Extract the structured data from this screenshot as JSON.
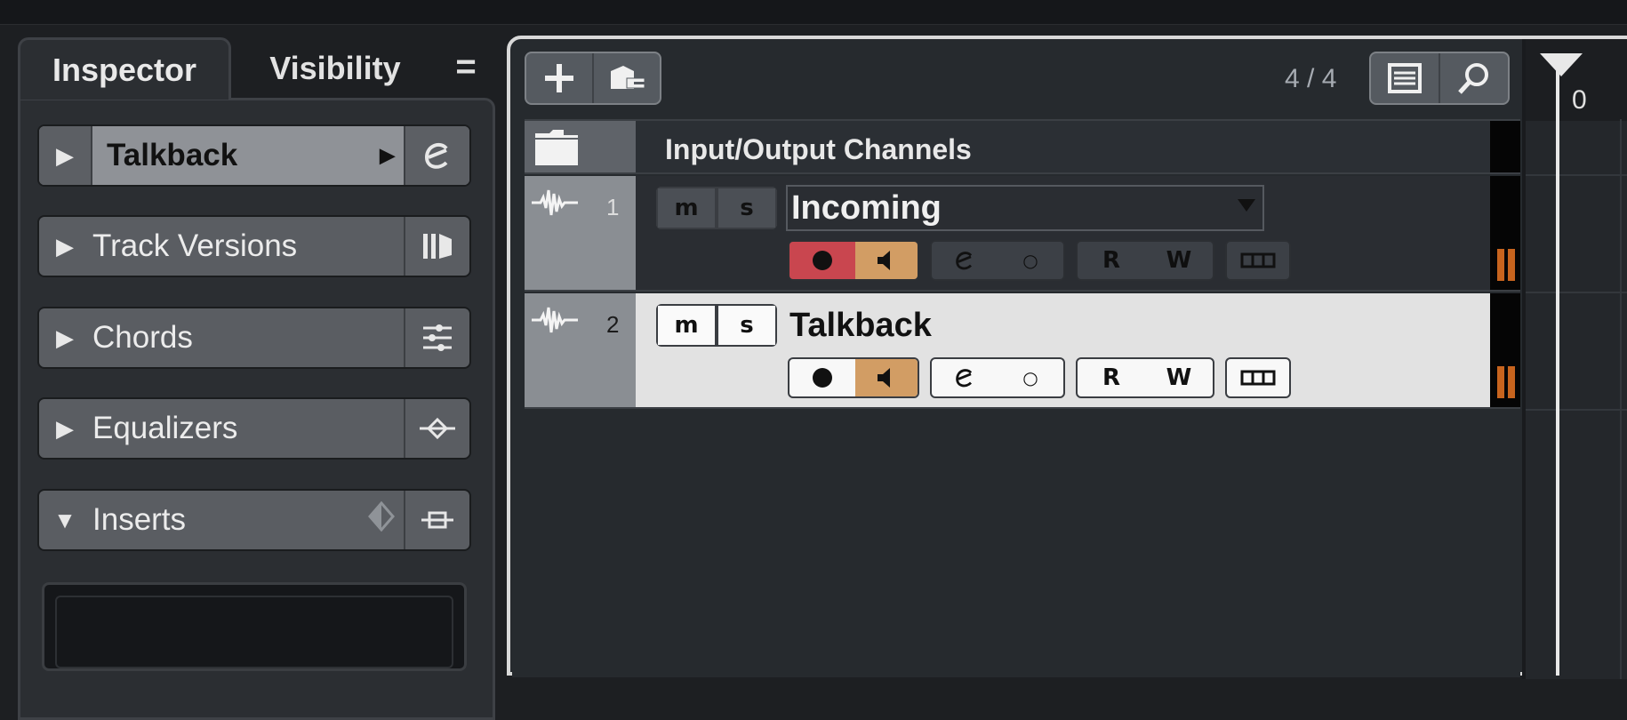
{
  "inspector": {
    "tabs": {
      "inspector": "Inspector",
      "visibility": "Visibility",
      "menu": "="
    },
    "sections": [
      {
        "label": "Talkback",
        "icon": "expression-icon",
        "expanded": false
      },
      {
        "label": "Track Versions",
        "icon": "track-versions-icon",
        "expanded": false
      },
      {
        "label": "Chords",
        "icon": "chords-icon",
        "expanded": false
      },
      {
        "label": "Equalizers",
        "icon": "equalizer-icon",
        "expanded": false
      },
      {
        "label": "Inserts",
        "icon": "inserts-icon",
        "expanded": true
      }
    ]
  },
  "tracklist": {
    "counter": "4 / 4",
    "folder": {
      "title": "Input/Output Channels"
    },
    "tracks": [
      {
        "number": "1",
        "name": "Incoming",
        "mute": "m",
        "solo": "s",
        "read": "R",
        "write": "W",
        "selected": false
      },
      {
        "number": "2",
        "name": "Talkback",
        "mute": "m",
        "solo": "s",
        "read": "R",
        "write": "W",
        "selected": true
      }
    ]
  },
  "ruler": {
    "start": "0"
  },
  "colors": {
    "record": "#c9464f",
    "monitor": "#d29d64",
    "meter": "#c7641e",
    "selected_track": "#e2e2e2"
  }
}
